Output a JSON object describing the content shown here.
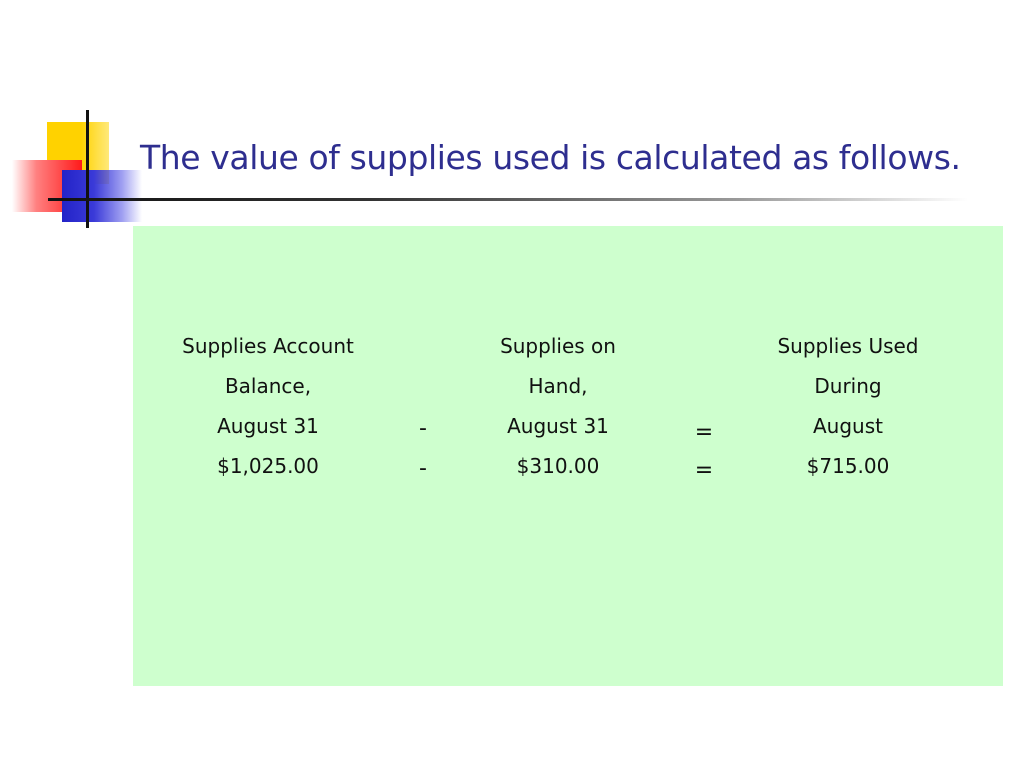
{
  "slide": {
    "title": "The value of supplies used is calculated as follows."
  },
  "colors": {
    "title": "#2e2e8f",
    "panel_background": "#ceffce",
    "logo_yellow": "#ffd200",
    "logo_red": "#ff1a1a",
    "logo_blue": "#2323c8"
  },
  "formula": {
    "balance": {
      "line1": "Supplies Account",
      "line2": "Balance,",
      "line3": "August 31",
      "amount": "$1,025.00"
    },
    "minus_symbol": "-",
    "on_hand": {
      "line1": "Supplies on",
      "line2": "Hand,",
      "line3": "August 31",
      "amount": "$310.00"
    },
    "equals_symbol": "=",
    "used": {
      "line1": "Supplies Used",
      "line2": "During",
      "line3": "August",
      "amount": "$715.00"
    }
  }
}
